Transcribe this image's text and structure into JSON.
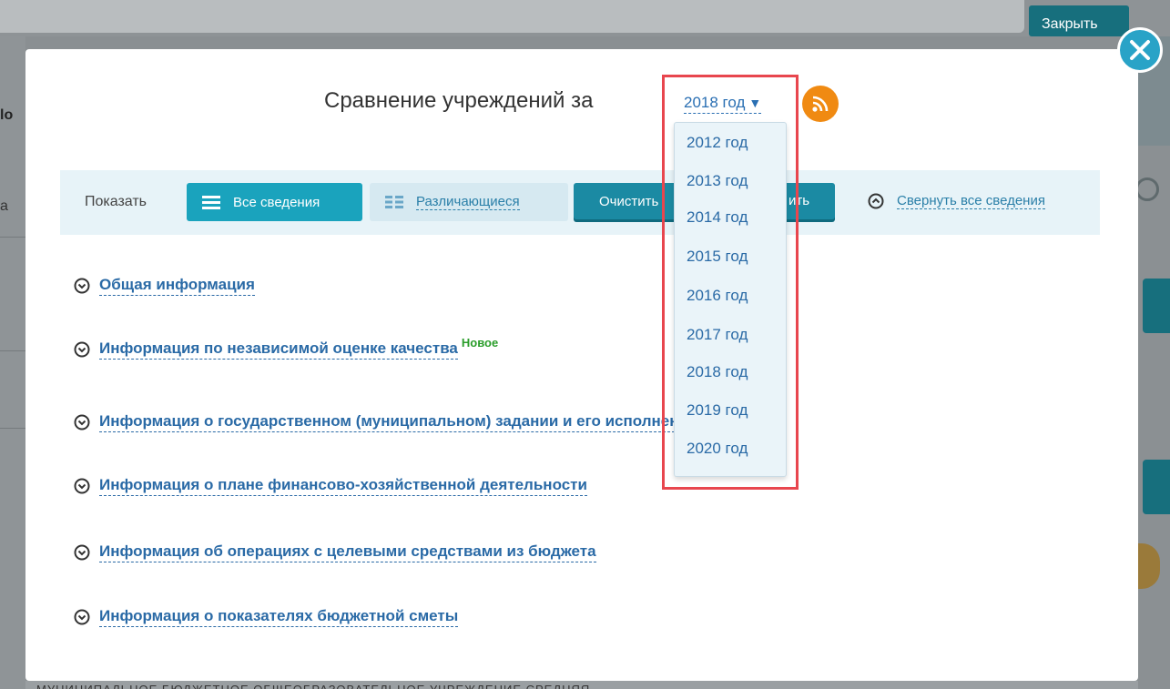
{
  "background": {
    "close_button_label": "Закрыть",
    "left_fragment_1": "lo",
    "left_fragment_2": "a",
    "bottom_text": "МУНИЦИПАЛЬНОЕ БЮДЖЕТНОЕ ОБЩЕОБРАЗОВАТЕЛЬНОЕ УЧРЕЖДЕНИЕ СРЕДНЯЯ"
  },
  "modal": {
    "title": "Сравнение учреждений за",
    "selected_year": "2018 год",
    "toolbar": {
      "show_label": "Показать",
      "all_info_label": "Все сведения",
      "differing_label": "Различающиеся",
      "clear_label": "Очистить",
      "clear_label_suffix": "ить",
      "collapse_all_label": "Свернуть все сведения"
    },
    "sections": [
      {
        "label": "Общая информация",
        "badge": ""
      },
      {
        "label": "Информация по независимой оценке качества",
        "badge": "Новое"
      },
      {
        "label": "Информация о государственном (муниципальном) задании и его исполнении",
        "badge": ""
      },
      {
        "label": "Информация о плане финансово-хозяйственной деятельности",
        "badge": ""
      },
      {
        "label": "Информация об операциях с целевыми средствами из бюджета",
        "badge": ""
      },
      {
        "label": "Информация о показателях бюджетной сметы",
        "badge": ""
      }
    ],
    "year_options": [
      "2012 год",
      "2013 год",
      "2014 год",
      "2015 год",
      "2016 год",
      "2017 год",
      "2018 год",
      "2019 год",
      "2020 год"
    ]
  },
  "icons": {
    "close": "close-x-icon",
    "rss": "rss-icon",
    "section_toggle": "chevron-down-circle-icon",
    "collapse": "chevron-up-circle-icon",
    "list": "list-icon",
    "grid": "grid-icon"
  },
  "colors": {
    "accent": "#1aa3bd",
    "link": "#2a6aa6",
    "badge_new": "#2a9d2a",
    "rss": "#f08a12",
    "highlight": "#e8464e"
  }
}
